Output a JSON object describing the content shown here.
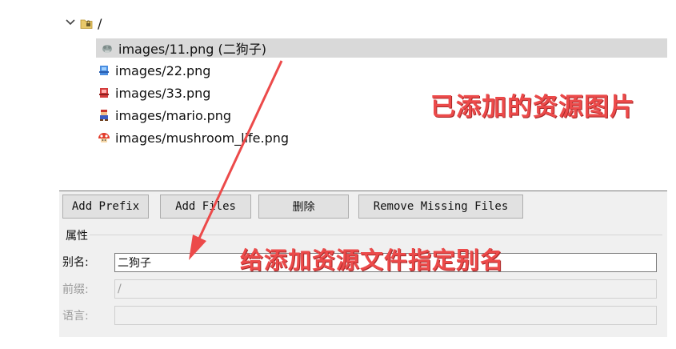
{
  "tree": {
    "root": {
      "label": "/"
    },
    "items": [
      {
        "label": "images/11.png (二狗子)",
        "icon": "dog-image-icon",
        "selected": true
      },
      {
        "label": "images/22.png",
        "icon": "blue-sprite-icon"
      },
      {
        "label": "images/33.png",
        "icon": "red-sprite-icon"
      },
      {
        "label": "images/mario.png",
        "icon": "mario-sprite-icon"
      },
      {
        "label": "images/mushroom_life.png",
        "icon": "mushroom-icon"
      }
    ]
  },
  "toolbar": {
    "add_prefix": "Add Prefix",
    "add_files": "Add Files",
    "delete": "删除",
    "remove_missing": "Remove Missing Files"
  },
  "properties": {
    "title": "属性",
    "alias_label": "别名:",
    "alias_value": "二狗子",
    "prefix_label": "前缀:",
    "prefix_value": "/",
    "lang_label": "语言:",
    "lang_value": ""
  },
  "annotations": {
    "top": "已添加的资源图片",
    "bottom": "给添加资源文件指定别名",
    "color": "#ec4a4a"
  }
}
